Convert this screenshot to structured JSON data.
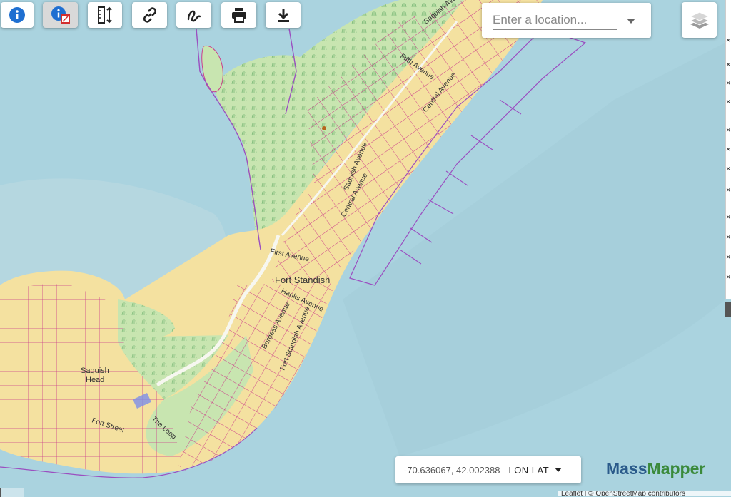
{
  "map": {
    "labels": {
      "saquish_avenue_top": "Saquish Avenue",
      "fifth_avenue": "Fifth Avenue",
      "central_avenue_top": "Central Avenue",
      "saquish_avenue_mid": "Saquish Avenue",
      "central_avenue_mid": "Central Avenue",
      "first_avenue": "First Avenue",
      "fort_standish": "Fort Standish",
      "hanks_avenue": "Hanks Avenue",
      "burgess_avenue": "Burgess Avenue",
      "fort_standish_avenue": "Fort Standish Avenue",
      "saquish_head_1": "Saquish",
      "saquish_head_2": "Head",
      "fort_street": "Fort Street",
      "the_loop": "The Loop"
    },
    "colors": {
      "water": "#aad3df",
      "beach": "#f4e1a0",
      "marsh": "#c8e5b0",
      "parcel": "#cc3d8a",
      "boundary": "#9b4fc0",
      "road": "#f7f7f0"
    }
  },
  "toolbar": {
    "buttons": [
      {
        "name": "identify",
        "icon": "info-circle-icon"
      },
      {
        "name": "identify-parcel",
        "icon": "info-parcel-icon"
      },
      {
        "name": "measure",
        "icon": "ruler-icon"
      },
      {
        "name": "link",
        "icon": "link-icon"
      },
      {
        "name": "draw",
        "icon": "squiggle-icon"
      },
      {
        "name": "print",
        "icon": "printer-icon"
      },
      {
        "name": "download",
        "icon": "download-icon"
      }
    ]
  },
  "search": {
    "placeholder": "Enter a location..."
  },
  "layers": {
    "icon": "layers-icon"
  },
  "coordinates": {
    "value": "-70.636067, 42.002388",
    "projection": "LON LAT"
  },
  "brand": {
    "part1": "Mass",
    "part2": "Mapper"
  },
  "attribution": "Leaflet | © OpenStreetMap contributors"
}
